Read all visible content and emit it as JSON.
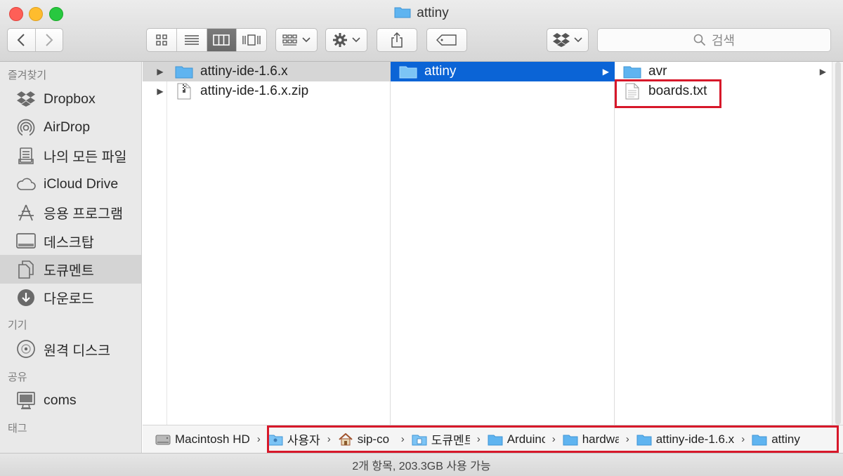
{
  "window": {
    "title": "attiny"
  },
  "search": {
    "placeholder": "검색"
  },
  "colors": {
    "selection_blue": "#0b64d6",
    "folder_blue": "#5fb4f0",
    "highlight_red": "#d7182a"
  },
  "sidebar": {
    "favorites_header": "즐겨찾기",
    "favorites": [
      {
        "label": "Dropbox",
        "icon": "dropbox-icon"
      },
      {
        "label": "AirDrop",
        "icon": "airdrop-icon"
      },
      {
        "label": "나의 모든 파일",
        "icon": "all-files-icon"
      },
      {
        "label": "iCloud Drive",
        "icon": "cloud-icon"
      },
      {
        "label": "응용 프로그램",
        "icon": "applications-icon"
      },
      {
        "label": "데스크탑",
        "icon": "desktop-icon"
      },
      {
        "label": "도큐멘트",
        "icon": "documents-icon"
      },
      {
        "label": "다운로드",
        "icon": "downloads-icon"
      }
    ],
    "devices_header": "기기",
    "devices": [
      {
        "label": "원격 디스크",
        "icon": "disc-icon"
      }
    ],
    "shared_header": "공유",
    "shared": [
      {
        "label": "coms",
        "icon": "computer-icon"
      }
    ],
    "tags_header": "태그"
  },
  "columns": {
    "col1": [
      {
        "name": "attiny-ide-1.6.x",
        "icon": "folder-icon"
      },
      {
        "name": "attiny-ide-1.6.x.zip",
        "icon": "zip-file-icon"
      }
    ],
    "col2": [
      {
        "name": "attiny",
        "icon": "folder-icon"
      }
    ],
    "col3": [
      {
        "name": "avr",
        "icon": "folder-icon"
      },
      {
        "name": "boards.txt",
        "icon": "text-file-icon"
      }
    ]
  },
  "pathbar": {
    "crumbs": [
      {
        "label": "Macintosh HD",
        "icon": "hard-drive-icon"
      },
      {
        "label": "사용자",
        "icon": "users-folder-icon"
      },
      {
        "label": "sip-co",
        "icon": "home-icon"
      },
      {
        "label": "도큐멘트",
        "icon": "documents-folder-icon"
      },
      {
        "label": "Arduino",
        "icon": "folder-icon"
      },
      {
        "label": "hardwa",
        "icon": "folder-icon"
      },
      {
        "label": "attiny-ide-1.6.x",
        "icon": "folder-icon"
      },
      {
        "label": "attiny",
        "icon": "folder-icon"
      }
    ]
  },
  "status": {
    "text": "2개 항목, 203.3GB 사용 가능"
  }
}
